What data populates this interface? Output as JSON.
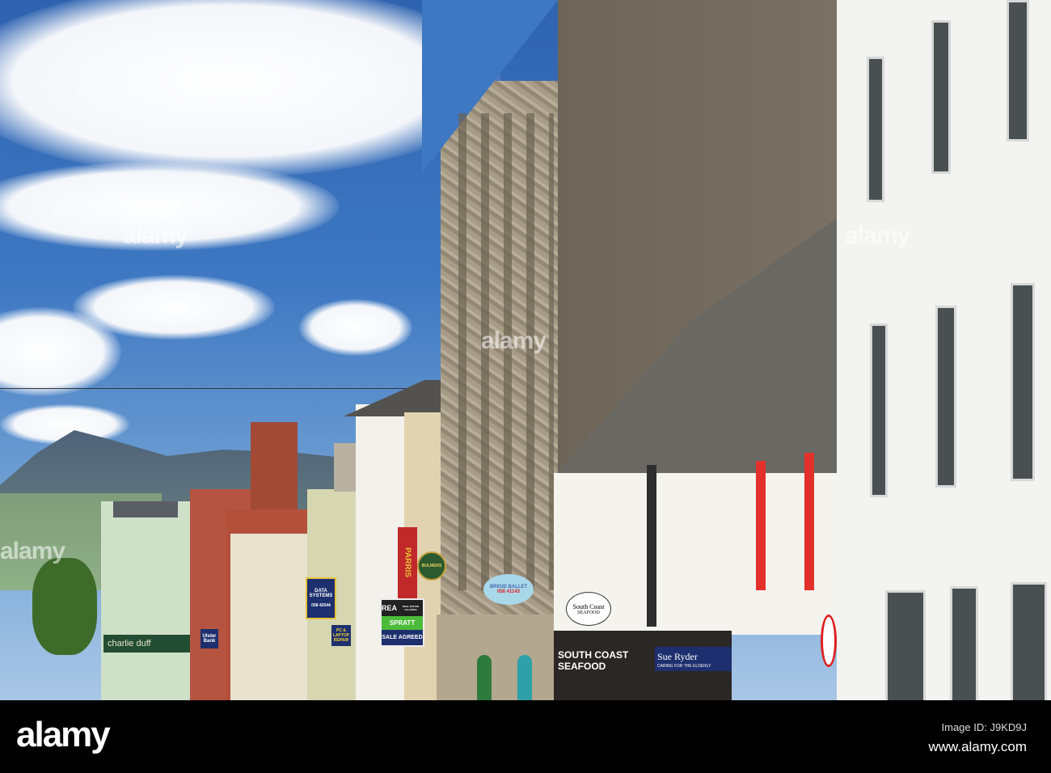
{
  "watermark": {
    "brand": "alamy",
    "image_id": "Image ID: J9KD9J",
    "url": "www.alamy.com"
  },
  "signs": {
    "data_systems": "DATA SYSTEMS",
    "data_phone": "058 42544",
    "pc_laptop": "PC & LAPTOP REPAIR",
    "rea": "REA",
    "rea_sub": "REAL ESTATE ALLIANCE",
    "spratt": "SPRATT",
    "sale_agreed": "SALE AGREED",
    "parris": "PARRIS",
    "bulmers": "BULMERS",
    "brigid": "BRIGID BALLET",
    "brigid_phone": "058 41143",
    "south_coast_hanging": "South Coast",
    "seafood_hanging": "SEAFOOD",
    "south_coast_fascia": "SOUTH COAST SEAFOOD",
    "sue_ryder": "Sue Ryder",
    "sue_ryder_tag": "CARING FOR THE ELDERLY",
    "ulster_bank": "Ulster Bank",
    "charlie": "charlie duff"
  },
  "colors": {
    "sky": "#3e78c2",
    "navy_sign": "#1d2f6e",
    "green_sign": "#4cbb3a",
    "red_sign": "#c0282a"
  }
}
